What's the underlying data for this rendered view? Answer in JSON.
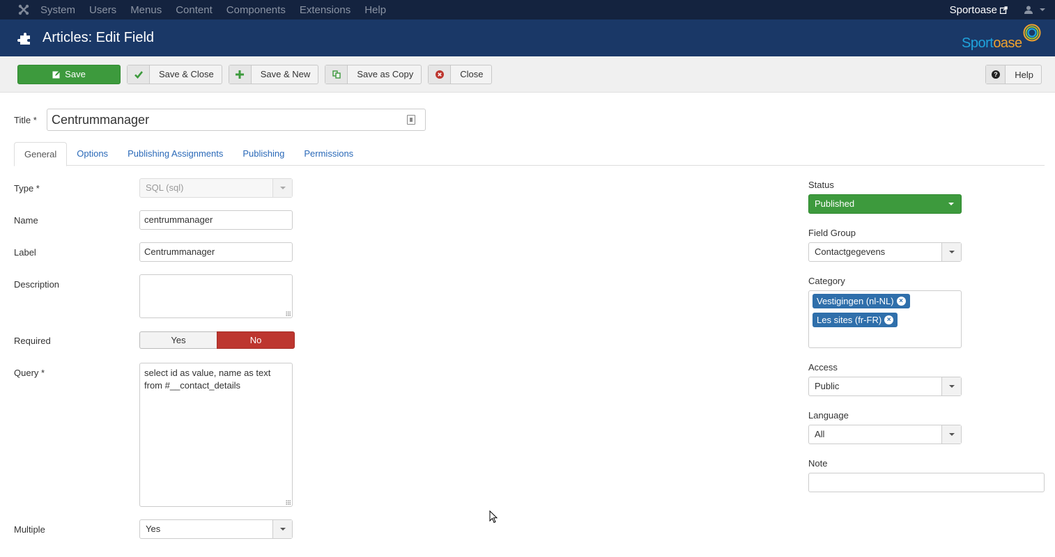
{
  "navbar": {
    "logo": "joomla-logo-icon",
    "menu": [
      "System",
      "Users",
      "Menus",
      "Content",
      "Components",
      "Extensions",
      "Help"
    ],
    "site_name": "Sportoase",
    "site_link_icon": "external-link-icon",
    "user_icon": "user-icon"
  },
  "header": {
    "icon": "puzzle-icon",
    "title": "Articles: Edit Field",
    "brand_part1": "Sport",
    "brand_part2": "oase"
  },
  "toolbar": {
    "save": "Save",
    "save_close": "Save & Close",
    "save_new": "Save & New",
    "save_copy": "Save as Copy",
    "close": "Close",
    "help": "Help"
  },
  "title_field": {
    "label": "Title *",
    "value": "Centrummanager"
  },
  "tabs": [
    {
      "label": "General",
      "active": true
    },
    {
      "label": "Options"
    },
    {
      "label": "Publishing Assignments"
    },
    {
      "label": "Publishing"
    },
    {
      "label": "Permissions"
    }
  ],
  "general": {
    "type": {
      "label": "Type *",
      "value": "SQL (sql)"
    },
    "name": {
      "label": "Name",
      "value": "centrummanager"
    },
    "field_label": {
      "label": "Label",
      "value": "Centrummanager"
    },
    "description": {
      "label": "Description",
      "value": ""
    },
    "required": {
      "label": "Required",
      "yes": "Yes",
      "no": "No",
      "selected": "No"
    },
    "query": {
      "label": "Query *",
      "line1": "select id as value, name as text",
      "line2": "from #__contact_details"
    },
    "multiple": {
      "label": "Multiple",
      "value": "Yes"
    }
  },
  "sidebar": {
    "status": {
      "label": "Status",
      "value": "Published"
    },
    "field_group": {
      "label": "Field Group",
      "value": "Contactgegevens"
    },
    "category": {
      "label": "Category",
      "tags": [
        "Vestigingen (nl-NL)",
        "Les sites (fr-FR)"
      ]
    },
    "access": {
      "label": "Access",
      "value": "Public"
    },
    "language": {
      "label": "Language",
      "value": "All"
    },
    "note": {
      "label": "Note",
      "value": ""
    }
  },
  "colors": {
    "navbar_bg": "#14233f",
    "header_bg": "#1a3867",
    "success": "#3d9a3d",
    "danger": "#bd362f",
    "link": "#2a69b8",
    "chip": "#2f6fab"
  }
}
